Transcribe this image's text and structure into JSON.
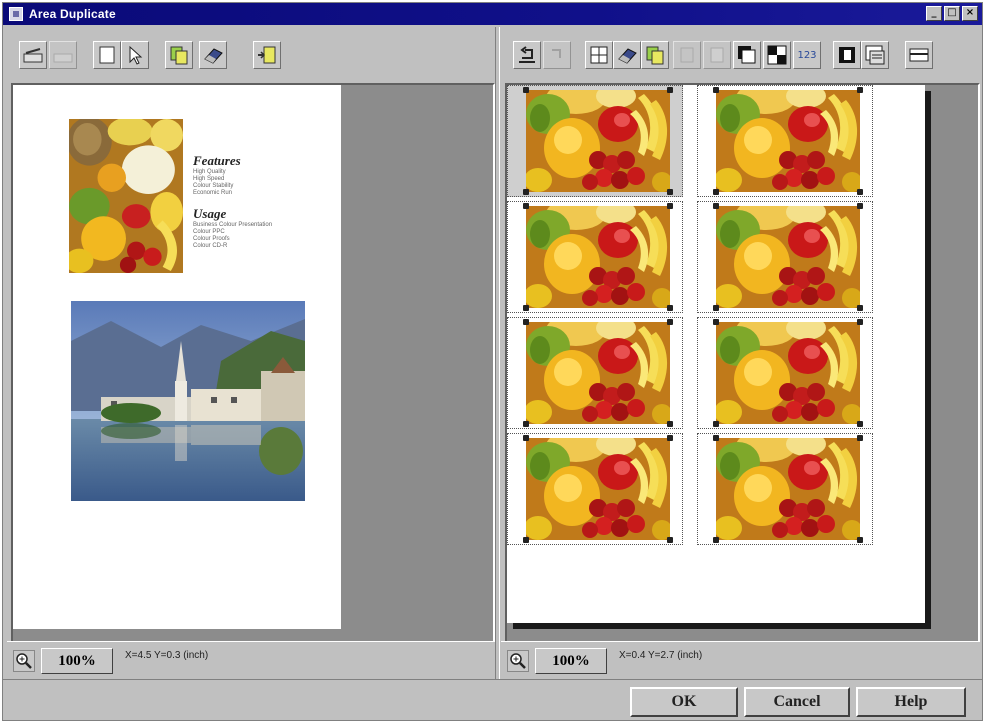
{
  "window": {
    "title": "Area Duplicate"
  },
  "title_buttons": {
    "minimize": "_",
    "maximize": "□",
    "close": "×"
  },
  "left_panel": {
    "brochure": {
      "heading_1": "Features",
      "lines_1": [
        "High Quality",
        "High Speed",
        "Colour Stability",
        "Economic Run"
      ],
      "heading_2": "Usage",
      "lines_2": [
        "Business Colour Presentation",
        "Colour PPC",
        "Colour Proofs",
        "Colour CD-R"
      ]
    },
    "zoom": "100%",
    "coordinates": "X=4.5 Y=0.3 (inch)"
  },
  "right_panel": {
    "zoom": "100%",
    "coordinates": "X=0.4 Y=2.7 (inch)",
    "toolbar_counter_label": "123",
    "grid": {
      "rows": 4,
      "columns": 2,
      "selected_cell": 1
    }
  },
  "footer": {
    "ok": "OK",
    "cancel": "Cancel",
    "help": "Help"
  },
  "icons": {
    "left_toolbar": [
      "scanner-icon",
      "scanner-disabled-icon",
      "page-icon",
      "pointer-arrow-icon",
      "duplicate-icon",
      "eraser-icon",
      "insert-page-icon"
    ],
    "right_toolbar": [
      "undo-icon",
      "redo-icon",
      "grid-icon",
      "eraser-icon",
      "duplicate-icon",
      "copy-disabled-icon",
      "paste-disabled-icon",
      "invert-icon",
      "checker-pattern-icon",
      "numbering-icon",
      "mirror-icon",
      "card-print-icon",
      "fit-width-icon"
    ]
  },
  "colors": {
    "title_bar": "#0a0a78",
    "face": "#c0c0c0",
    "workspace": "#8c8c8c"
  }
}
